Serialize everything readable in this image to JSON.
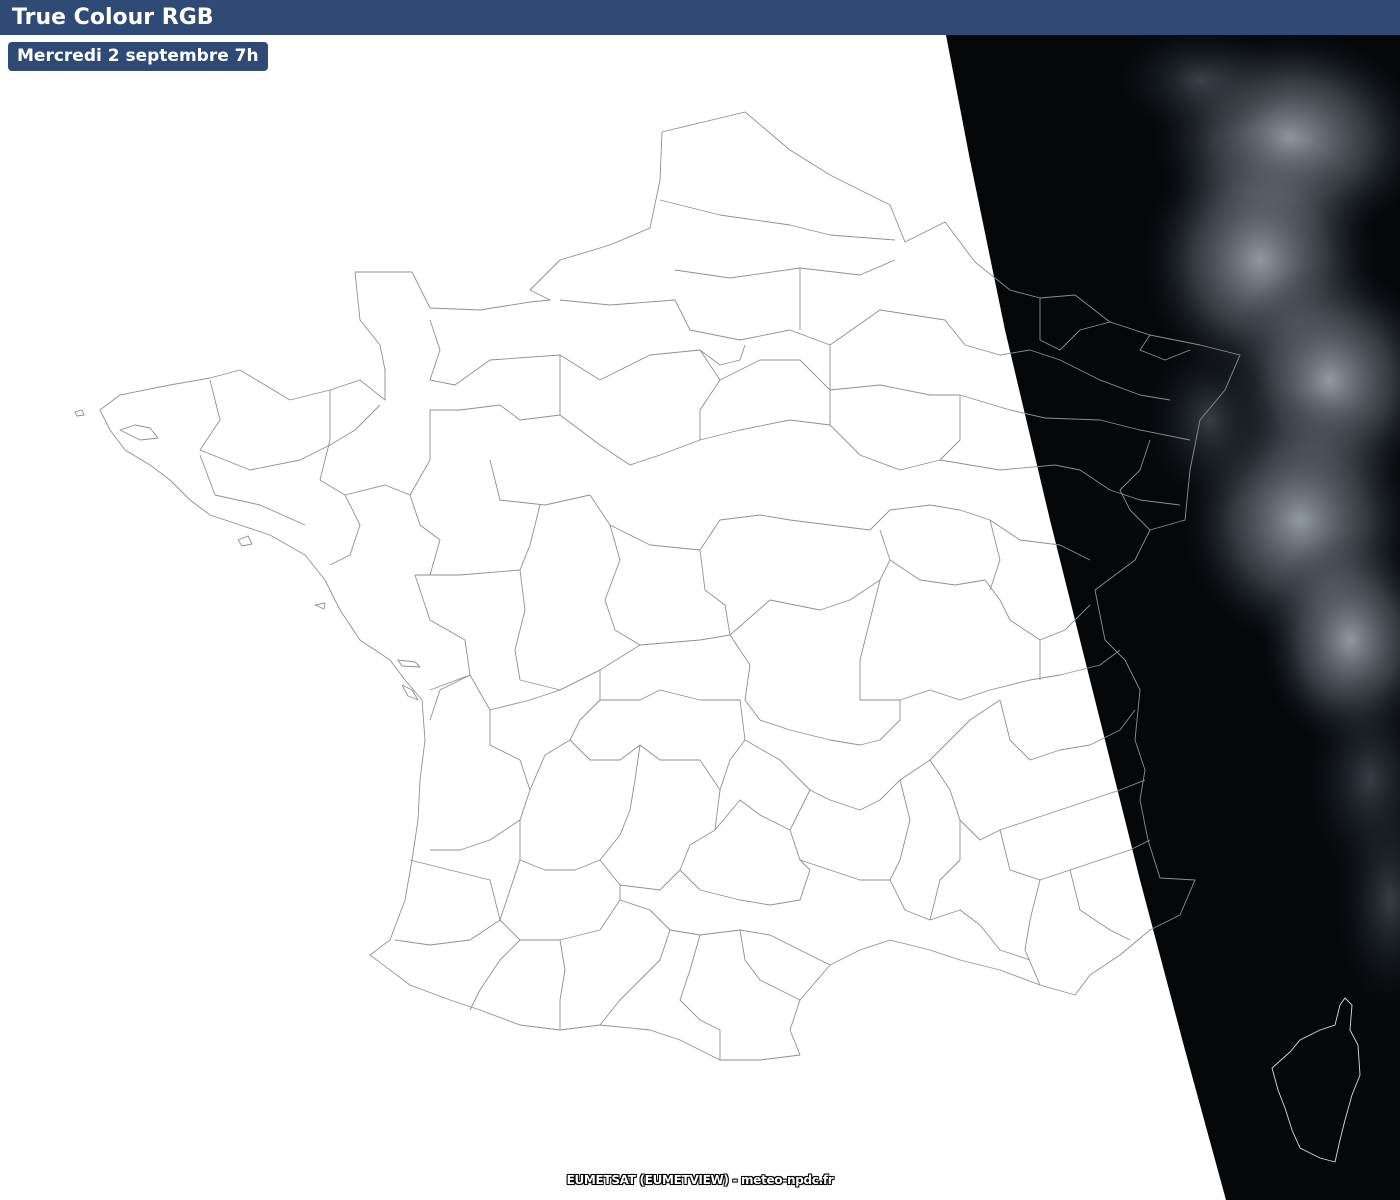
{
  "header": {
    "title": "True Colour RGB"
  },
  "timestamp": {
    "label": "Mercredi 2 septembre 7h"
  },
  "map": {
    "layer": "true-colour-rgb-satellite",
    "region": "France",
    "boundaries": "departements",
    "colors": {
      "header_bg": "#2e4a75",
      "land_outline": "#8f8f8f",
      "satellite_dark": "#050709",
      "cloud": "#9aa3ae"
    }
  },
  "footer": {
    "credit": "EUMETSAT (EUMETVIEW) - meteo-npdc.fr"
  }
}
